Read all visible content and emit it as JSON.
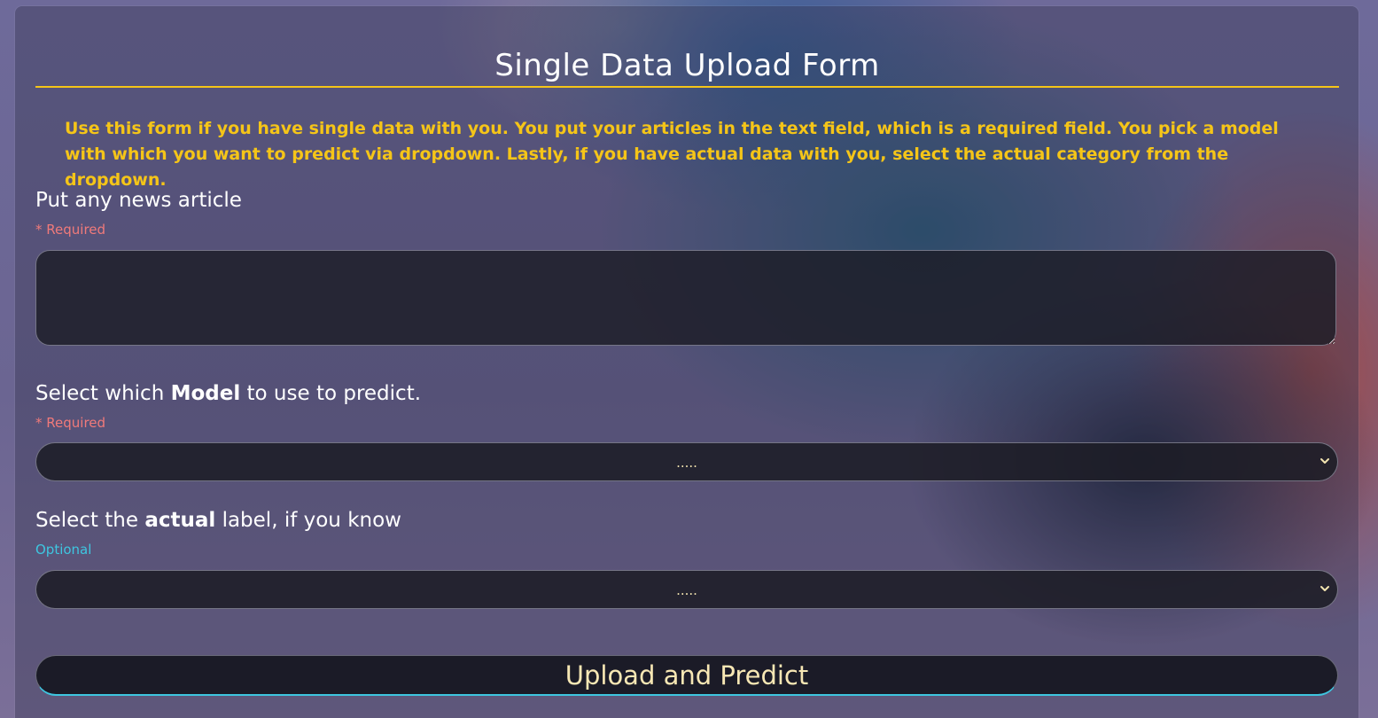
{
  "form": {
    "title": "Single Data Upload Form",
    "description": "Use this form if you have single data with you. You put your articles in the text field, which is a required field. You pick a model with which you want to predict via dropdown. Lastly, if you have actual data with you, select the actual category from the dropdown.",
    "article": {
      "label": "Put any news article",
      "hint": "* Required",
      "value": ""
    },
    "model": {
      "label_before": "Select which ",
      "label_bold": "Model",
      "label_after": " to use to predict.",
      "hint": "* Required",
      "selected": ".....",
      "icon": "chevron-down-icon"
    },
    "actual": {
      "label_before": "Select the ",
      "label_bold": "actual",
      "label_after": " label, if you know",
      "hint": "Optional",
      "selected": ".....",
      "icon": "chevron-down-icon"
    },
    "submit_label": "Upload and Predict"
  },
  "colors": {
    "accent_yellow": "#f5c518",
    "required_red": "#f07a7a",
    "optional_cyan": "#3ec6e0",
    "button_text": "#f7e7b4"
  }
}
